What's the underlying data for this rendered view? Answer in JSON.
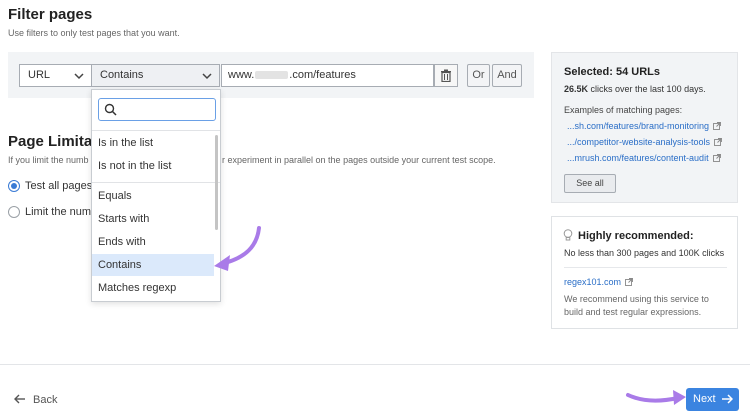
{
  "header": {
    "title": "Filter pages",
    "subtitle": "Use filters to only test pages that you want."
  },
  "filter": {
    "field": "URL",
    "operator": "Contains",
    "url_prefix": "www.",
    "url_suffix": ".com/features",
    "or_label": "Or",
    "and_label": "And"
  },
  "dropdown": {
    "search_placeholder": "",
    "items": [
      "Is in the list",
      "Is not in the list",
      "Equals",
      "Starts with",
      "Ends with",
      "Contains",
      "Matches regexp"
    ],
    "selected": "Contains"
  },
  "limitation": {
    "title": "Page Limitati",
    "desc_left": "If you limit the numb",
    "desc_right": "r experiment in parallel on the pages outside your current test scope.",
    "option1": "Test all pages",
    "option2": "Limit the num"
  },
  "selected_panel": {
    "title": "Selected: 54 URLs",
    "clicks_bold": "26.5K",
    "clicks_rest": " clicks over the last 100 days.",
    "examples_label": "Examples of matching pages:",
    "links": [
      "...sh.com/features/brand-monitoring",
      ".../competitor-website-analysis-tools",
      "...mrush.com/features/content-audit"
    ],
    "see_all": "See all"
  },
  "recommend_panel": {
    "title": "Highly recommended:",
    "text": "No less than 300 pages and 100K clicks",
    "link": "regex101.com",
    "desc": "We recommend using this service to build and test regular expressions."
  },
  "footer": {
    "back": "Back",
    "next": "Next"
  },
  "colors": {
    "accent": "#3b84e0",
    "link": "#2a6ec7",
    "annotation": "#a97be8"
  }
}
